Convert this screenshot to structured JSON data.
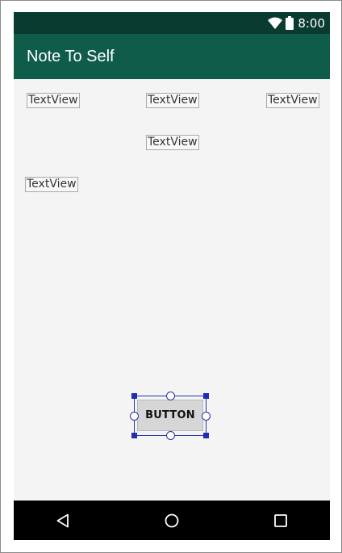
{
  "status_bar": {
    "time": "8:00",
    "wifi_icon": "wifi-icon",
    "battery_icon": "battery-icon"
  },
  "app_bar": {
    "title": "Note To Self"
  },
  "content": {
    "textviews": [
      "TextView",
      "TextView",
      "TextView",
      "TextView",
      "TextView"
    ],
    "button_label": "BUTTON"
  },
  "nav_bar": {
    "back_icon": "back-triangle-icon",
    "home_icon": "home-circle-icon",
    "recents_icon": "recents-square-icon"
  },
  "colors": {
    "status_bar": "#0a3b31",
    "app_bar": "#0f5c4b",
    "background": "#f4f4f4",
    "selection": "#2233aa"
  }
}
